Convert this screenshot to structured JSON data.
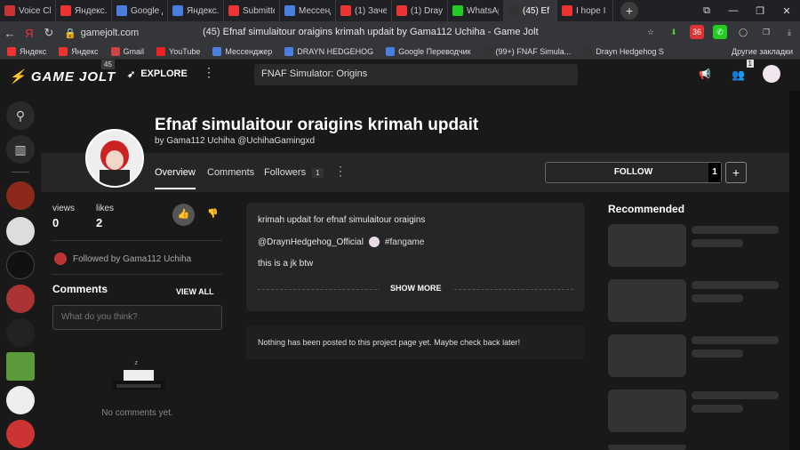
{
  "tabs": [
    {
      "label": "Voice Ch",
      "color": "#c33"
    },
    {
      "label": "Яндекс.Д",
      "color": "#e33"
    },
    {
      "label": "Google Д",
      "color": "#4a7fe0"
    },
    {
      "label": "Яндекс.Д",
      "color": "#4a7fe0"
    },
    {
      "label": "Submitte",
      "color": "#e33"
    },
    {
      "label": "Мессенд",
      "color": "#4a7fe0"
    },
    {
      "label": "(1) Заче",
      "color": "#e33"
    },
    {
      "label": "(1) Drayn",
      "color": "#e33"
    },
    {
      "label": "WhatsAp",
      "color": "#2c2"
    },
    {
      "label": "(45) Ef",
      "color": "#333"
    },
    {
      "label": "I hope I",
      "color": "#e33"
    }
  ],
  "browser": {
    "url": "gamejolt.com",
    "page_title": "(45) Efnaf simulaitour oraigins krimah updait by Gama112 Uchiha - Game Jolt",
    "bookmarks": [
      "Яндекс",
      "Яндекс",
      "Gmail",
      "YouTube",
      "Мессенджер",
      "DRAYN HEDGEHOG",
      "Google Переводчик",
      "(99+) FNAF Simula...",
      "Drayn Hedgehog S"
    ],
    "bookmarks_more": "Другие закладки",
    "ext_badge": "36"
  },
  "gj": {
    "logo": "GAME JOLT",
    "logo_badge": "45",
    "explore": "EXPLORE",
    "search": "FNAF Simulator: Origins",
    "notif_count": "1"
  },
  "game": {
    "title": "Efnaf simulaitour oraigins krimah updait",
    "byline": "by Gama112 Uchiha @UchihaGamingxd",
    "tabs": {
      "overview": "Overview",
      "comments": "Comments",
      "followers": "Followers",
      "followers_count": "1"
    },
    "follow_label": "FOLLOW",
    "follow_count": "1",
    "plus": "+",
    "views_label": "views",
    "views": "0",
    "likes_label": "likes",
    "likes": "2",
    "followed_by": "Followed by Gama112 Uchiha",
    "comments_heading": "Comments",
    "view_all": "VIEW ALL",
    "comment_placeholder": "What do you think?",
    "no_comments": "No comments yet."
  },
  "post": {
    "line1": "krimah updait for efnaf simulaitour oraigins",
    "mention": "@DraynHedgehog_Official",
    "hashtag": "#fangame",
    "line3": "this is a jk btw",
    "show_more": "SHOW MORE",
    "empty": "Nothing has been posted to this project page yet. Maybe check back later!"
  },
  "recommended": "Recommended"
}
